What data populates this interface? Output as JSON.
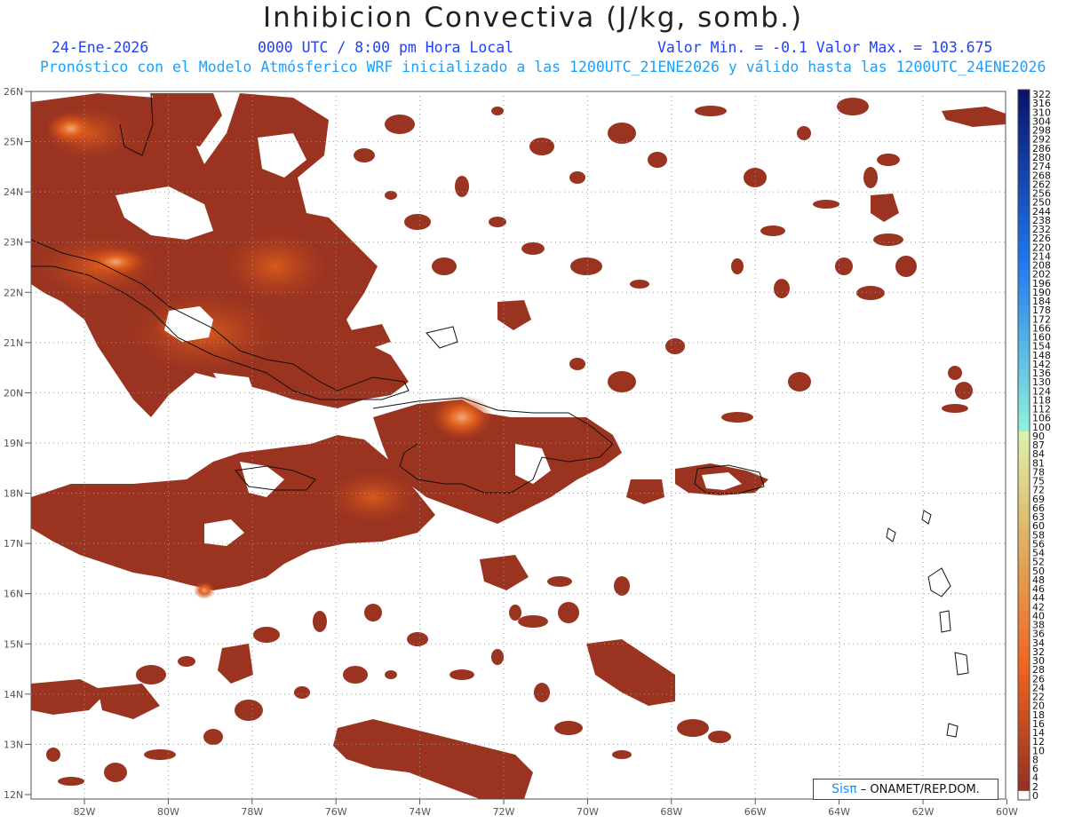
{
  "header": {
    "title": "Inhibicion Convectiva (J/kg, somb.)",
    "date": "24-Ene-2026",
    "time": "0000 UTC / 8:00 pm Hora Local",
    "minmax": "Valor Min. = -0.1  Valor Max. = 103.675",
    "forecast_line": "Pronóstico con el Modelo Atmósferico WRF inicializado a las 1200UTC_21ENE2026 y válido hasta las  1200UTC_24ENE2026"
  },
  "map": {
    "lat_labels": [
      "26N",
      "25N",
      "24N",
      "23N",
      "22N",
      "21N",
      "20N",
      "19N",
      "18N",
      "17N",
      "16N",
      "15N",
      "14N",
      "13N",
      "12N"
    ],
    "lon_labels": [
      "82W",
      "80W",
      "78W",
      "76W",
      "74W",
      "72W",
      "70W",
      "68W",
      "66W",
      "64W",
      "62W",
      "60W"
    ],
    "field_colors": {
      "low": "#8e2f20",
      "mid": "#c4461e",
      "high": "#e8621c",
      "peak": "#f0a070"
    }
  },
  "colorbar": {
    "labels": [
      "322",
      "316",
      "310",
      "304",
      "298",
      "292",
      "286",
      "280",
      "274",
      "268",
      "262",
      "256",
      "250",
      "244",
      "238",
      "232",
      "226",
      "220",
      "214",
      "208",
      "202",
      "196",
      "190",
      "184",
      "178",
      "172",
      "166",
      "160",
      "154",
      "148",
      "142",
      "136",
      "130",
      "124",
      "118",
      "112",
      "106",
      "100",
      "90",
      "87",
      "84",
      "81",
      "78",
      "75",
      "72",
      "69",
      "66",
      "63",
      "60",
      "58",
      "56",
      "54",
      "52",
      "50",
      "48",
      "46",
      "44",
      "42",
      "40",
      "38",
      "36",
      "34",
      "32",
      "30",
      "28",
      "26",
      "24",
      "22",
      "20",
      "18",
      "16",
      "14",
      "12",
      "10",
      "8",
      "6",
      "4",
      "2",
      "0"
    ]
  },
  "credit": {
    "sis": "Sisπ",
    "text": "– ONAMET/REP.DOM."
  }
}
